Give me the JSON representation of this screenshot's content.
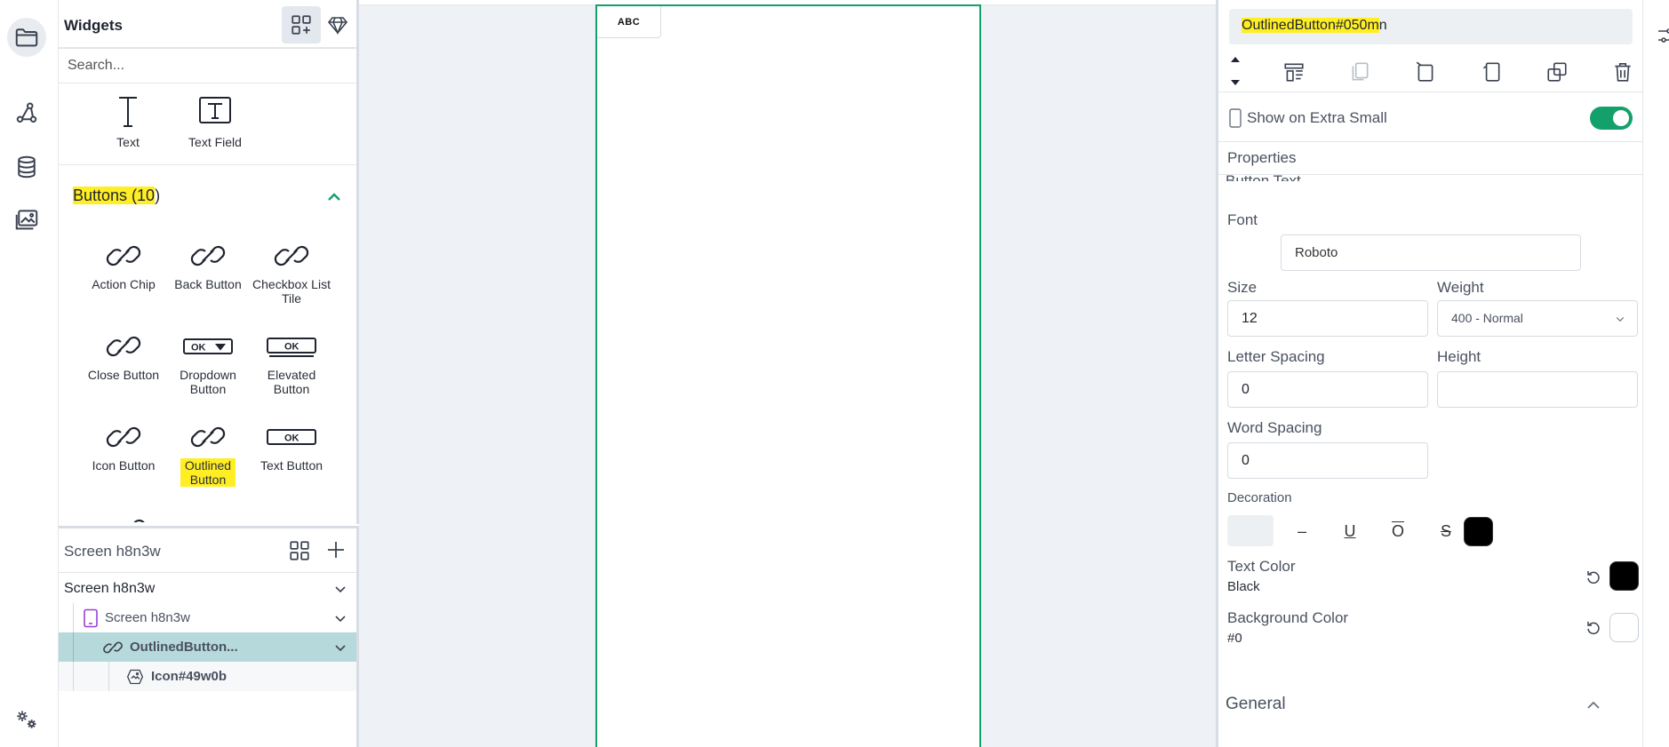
{
  "widgets_panel": {
    "title": "Widgets",
    "search_placeholder": "Search...",
    "top_tiles": [
      {
        "label": "Text",
        "icon": "text-icon"
      },
      {
        "label": "Text Field",
        "icon": "text-field-icon"
      }
    ],
    "buttons_section": {
      "heading_highlighted": "Buttons (10",
      "heading_rest": ")",
      "tiles": [
        {
          "label": "Action Chip",
          "icon": "link-icon"
        },
        {
          "label": "Back Button",
          "icon": "link-icon"
        },
        {
          "label": "Checkbox List Tile",
          "icon": "link-icon"
        },
        {
          "label": "Close Button",
          "icon": "link-icon"
        },
        {
          "label": "Dropdown Button",
          "icon": "dropdown-button-icon"
        },
        {
          "label": "Elevated Button",
          "icon": "elevated-button-icon"
        },
        {
          "label": "Icon Button",
          "icon": "link-icon"
        },
        {
          "label": "Outlined Button",
          "icon": "link-icon"
        },
        {
          "label": "Text Button",
          "icon": "text-button-icon"
        }
      ]
    },
    "ok_text": "OK"
  },
  "tree_panel": {
    "title": "Screen h8n3w",
    "rows": [
      {
        "label": "Screen h8n3w"
      },
      {
        "label": "Screen h8n3w"
      },
      {
        "label": "OutlinedButton..."
      },
      {
        "label": "Icon#49w0b"
      }
    ]
  },
  "canvas": {
    "button_text": "ABC"
  },
  "properties": {
    "widget_id_highlighted": "OutlinedButton#050m",
    "widget_id_rest": "n",
    "show_on_label": "Show on Extra Small",
    "show_on_enabled": true,
    "section_title": "Properties",
    "button_text_label": "Button Text",
    "font_label": "Font",
    "font_value": "Roboto",
    "size_label": "Size",
    "size_value": "12",
    "weight_label": "Weight",
    "weight_value": "400 - Normal",
    "letter_spacing_label": "Letter Spacing",
    "letter_spacing_value": "0",
    "height_label": "Height",
    "height_value": "",
    "word_spacing_label": "Word Spacing",
    "word_spacing_value": "0",
    "decoration_label": "Decoration",
    "text_color_label": "Text Color",
    "text_color_value": "Black",
    "text_color_hex": "#000000",
    "bg_color_label": "Background Color",
    "bg_color_value": "#0",
    "general_label": "General"
  },
  "colors": {
    "accent": "#14a06b",
    "highlight": "#ffee24",
    "tree_selected": "#b6d9dc"
  }
}
